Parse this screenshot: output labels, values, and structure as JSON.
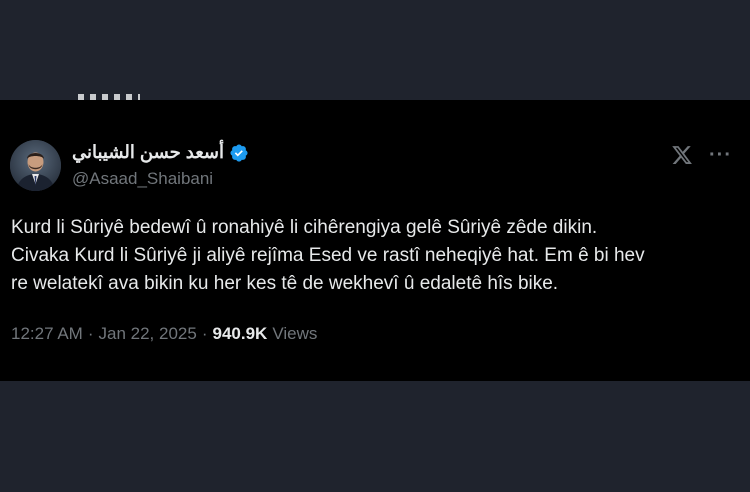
{
  "tweet": {
    "author": {
      "display_name": "أسعد حسن الشيباني",
      "handle": "@Asaad_Shaibani",
      "verified": true
    },
    "text": "Kurd li Sûriyê bedewî û ronahiyê li cihêrengiya gelê Sûriyê zêde dikin.\nCivaka Kurd li Sûriyê ji aliyê rejîma Esed ve rastî neheqiyê hat. Em ê bi hev\nre welatekî ava bikin ku her kes tê de wekhevî û edaletê hîs bike.",
    "time": "12:27 AM",
    "separator": "·",
    "date": "Jan 22, 2025",
    "views_count": "940.9K",
    "views_label": "Views"
  },
  "colors": {
    "background": "#1f232d",
    "card": "#000000",
    "text": "#e7e9ea",
    "muted": "#71767b",
    "verified": "#1d9bf0"
  },
  "icons": {
    "verified": "verified-badge-icon",
    "platform": "x-logo-icon",
    "more": "more-options-icon"
  }
}
